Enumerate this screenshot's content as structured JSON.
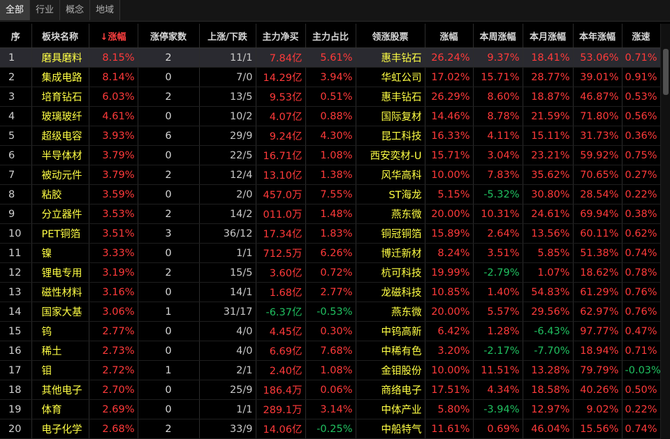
{
  "tabs": [
    "全部",
    "行业",
    "概念",
    "地域"
  ],
  "columns": [
    "序",
    "板块名称",
    "涨幅",
    "涨停家数",
    "上涨/下跌",
    "主力净买",
    "主力占比",
    "领涨股票",
    "涨幅",
    "本周涨幅",
    "本月涨幅",
    "本年涨幅",
    "涨速"
  ],
  "rows": [
    {
      "idx": "1",
      "name": "磨具磨料",
      "chg": "8.15%",
      "limit": "2",
      "updown": "11/1",
      "net": "7.84亿",
      "ratio": "5.61%",
      "stock": "惠丰钻石",
      "schg": "26.24%",
      "week": "9.37%",
      "month": "18.41%",
      "year": "53.06%",
      "speed": "0.71%"
    },
    {
      "idx": "2",
      "name": "集成电路",
      "chg": "8.14%",
      "limit": "0",
      "updown": "7/0",
      "net": "14.29亿",
      "ratio": "3.94%",
      "stock": "华虹公司",
      "schg": "17.02%",
      "week": "15.71%",
      "month": "28.77%",
      "year": "39.01%",
      "speed": "0.91%"
    },
    {
      "idx": "3",
      "name": "培育钻石",
      "chg": "6.03%",
      "limit": "2",
      "updown": "13/5",
      "net": "9.53亿",
      "ratio": "0.51%",
      "stock": "惠丰钻石",
      "schg": "26.29%",
      "week": "8.60%",
      "month": "18.87%",
      "year": "46.87%",
      "speed": "0.53%"
    },
    {
      "idx": "4",
      "name": "玻璃玻纤",
      "chg": "4.61%",
      "limit": "0",
      "updown": "10/2",
      "net": "4.07亿",
      "ratio": "0.88%",
      "stock": "国际复材",
      "schg": "14.46%",
      "week": "8.78%",
      "month": "21.59%",
      "year": "71.80%",
      "speed": "0.56%"
    },
    {
      "idx": "5",
      "name": "超级电容",
      "chg": "3.93%",
      "limit": "6",
      "updown": "29/9",
      "net": "9.24亿",
      "ratio": "4.30%",
      "stock": "昆工科技",
      "schg": "16.33%",
      "week": "4.11%",
      "month": "15.11%",
      "year": "31.73%",
      "speed": "0.36%"
    },
    {
      "idx": "6",
      "name": "半导体材",
      "chg": "3.79%",
      "limit": "0",
      "updown": "22/5",
      "net": "16.71亿",
      "ratio": "1.08%",
      "stock": "西安奕材-U",
      "schg": "15.71%",
      "week": "3.04%",
      "month": "23.21%",
      "year": "59.92%",
      "speed": "0.75%"
    },
    {
      "idx": "7",
      "name": "被动元件",
      "chg": "3.79%",
      "limit": "2",
      "updown": "12/4",
      "net": "13.10亿",
      "ratio": "1.38%",
      "stock": "风华高科",
      "schg": "10.00%",
      "week": "7.83%",
      "month": "35.62%",
      "year": "70.65%",
      "speed": "0.27%"
    },
    {
      "idx": "8",
      "name": "粘胶",
      "chg": "3.59%",
      "limit": "0",
      "updown": "2/0",
      "net": "457.0万",
      "ratio": "7.55%",
      "stock": "ST海龙",
      "schg": "5.15%",
      "week": "-5.32%",
      "month": "30.80%",
      "year": "28.54%",
      "speed": "0.22%"
    },
    {
      "idx": "9",
      "name": "分立器件",
      "chg": "3.53%",
      "limit": "2",
      "updown": "14/2",
      "net": "011.0万",
      "ratio": "1.48%",
      "stock": "燕东微",
      "schg": "20.00%",
      "week": "10.31%",
      "month": "24.61%",
      "year": "69.94%",
      "speed": "0.38%"
    },
    {
      "idx": "10",
      "name": "PET铜箔",
      "chg": "3.51%",
      "limit": "3",
      "updown": "36/12",
      "net": "17.34亿",
      "ratio": "1.83%",
      "stock": "铜冠铜箔",
      "schg": "15.89%",
      "week": "2.64%",
      "month": "13.56%",
      "year": "60.11%",
      "speed": "0.62%"
    },
    {
      "idx": "11",
      "name": "镍",
      "chg": "3.33%",
      "limit": "0",
      "updown": "1/1",
      "net": "712.5万",
      "ratio": "6.26%",
      "stock": "博迁新材",
      "schg": "8.24%",
      "week": "3.51%",
      "month": "5.85%",
      "year": "51.38%",
      "speed": "0.74%"
    },
    {
      "idx": "12",
      "name": "锂电专用",
      "chg": "3.19%",
      "limit": "2",
      "updown": "15/5",
      "net": "3.60亿",
      "ratio": "0.72%",
      "stock": "杭可科技",
      "schg": "19.99%",
      "week": "-2.79%",
      "month": "1.07%",
      "year": "18.62%",
      "speed": "0.78%"
    },
    {
      "idx": "13",
      "name": "磁性材料",
      "chg": "3.16%",
      "limit": "0",
      "updown": "14/1",
      "net": "1.68亿",
      "ratio": "2.77%",
      "stock": "龙磁科技",
      "schg": "10.85%",
      "week": "1.40%",
      "month": "54.83%",
      "year": "61.29%",
      "speed": "0.76%"
    },
    {
      "idx": "14",
      "name": "国家大基",
      "chg": "3.06%",
      "limit": "1",
      "updown": "31/17",
      "net": "-6.37亿",
      "ratio": "-0.53%",
      "stock": "燕东微",
      "schg": "20.00%",
      "week": "5.57%",
      "month": "29.56%",
      "year": "62.97%",
      "speed": "0.76%"
    },
    {
      "idx": "15",
      "name": "钨",
      "chg": "2.77%",
      "limit": "0",
      "updown": "4/0",
      "net": "4.45亿",
      "ratio": "0.30%",
      "stock": "中钨高新",
      "schg": "6.42%",
      "week": "1.28%",
      "month": "-6.43%",
      "year": "97.77%",
      "speed": "0.47%"
    },
    {
      "idx": "16",
      "name": "稀土",
      "chg": "2.73%",
      "limit": "0",
      "updown": "4/0",
      "net": "6.69亿",
      "ratio": "7.68%",
      "stock": "中稀有色",
      "schg": "3.20%",
      "week": "-2.17%",
      "month": "-7.70%",
      "year": "18.94%",
      "speed": "0.71%"
    },
    {
      "idx": "17",
      "name": "钼",
      "chg": "2.72%",
      "limit": "1",
      "updown": "2/1",
      "net": "2.40亿",
      "ratio": "1.08%",
      "stock": "金钼股份",
      "schg": "10.00%",
      "week": "11.51%",
      "month": "13.28%",
      "year": "79.79%",
      "speed": "-0.03%"
    },
    {
      "idx": "18",
      "name": "其他电子",
      "chg": "2.70%",
      "limit": "0",
      "updown": "25/9",
      "net": "186.4万",
      "ratio": "0.06%",
      "stock": "商络电子",
      "schg": "17.51%",
      "week": "4.34%",
      "month": "18.58%",
      "year": "40.26%",
      "speed": "0.50%"
    },
    {
      "idx": "19",
      "name": "体育",
      "chg": "2.69%",
      "limit": "0",
      "updown": "1/1",
      "net": "289.1万",
      "ratio": "3.14%",
      "stock": "中体产业",
      "schg": "5.80%",
      "week": "-3.94%",
      "month": "12.97%",
      "year": "9.02%",
      "speed": "0.22%"
    },
    {
      "idx": "20",
      "name": "电子化学",
      "chg": "2.68%",
      "limit": "2",
      "updown": "33/9",
      "net": "14.06亿",
      "ratio": "-0.25%",
      "stock": "中船特气",
      "schg": "11.61%",
      "week": "0.69%",
      "month": "46.04%",
      "year": "15.56%",
      "speed": "0.74%"
    }
  ],
  "colors": {
    "up": "#ff3a3a",
    "down": "#20c060",
    "name": "#ffff45",
    "flat": "#e6e6e6"
  }
}
